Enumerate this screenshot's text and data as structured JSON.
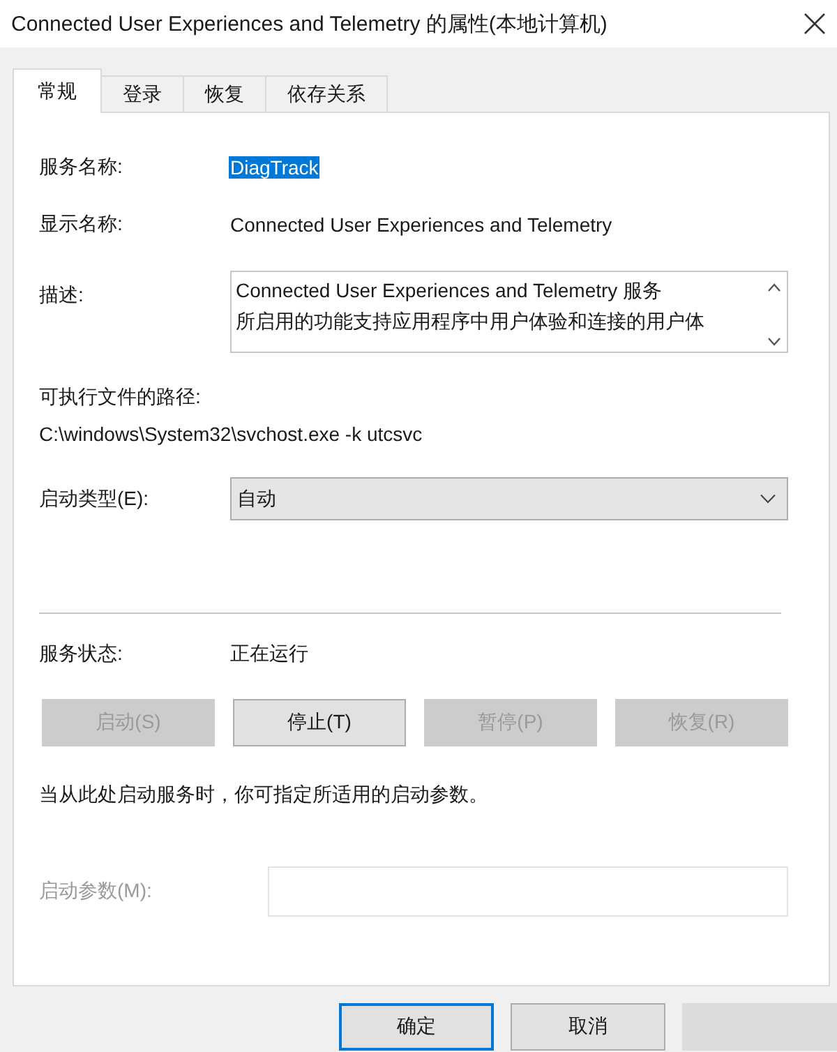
{
  "window": {
    "title": "Connected User Experiences and Telemetry 的属性(本地计算机)"
  },
  "tabs": [
    {
      "label": "常规",
      "selected": true
    },
    {
      "label": "登录",
      "selected": false
    },
    {
      "label": "恢复",
      "selected": false
    },
    {
      "label": "依存关系",
      "selected": false
    }
  ],
  "service_name": {
    "label": "服务名称:",
    "value": "DiagTrack",
    "highlighted": true
  },
  "display_name": {
    "label": "显示名称:",
    "value": "Connected User Experiences and Telemetry"
  },
  "description": {
    "label": "描述:",
    "lines": [
      "Connected User Experiences and Telemetry 服务",
      "所启用的功能支持应用程序中用户体验和连接的用户体"
    ]
  },
  "executable_path": {
    "label": "可执行文件的路径:",
    "value": "C:\\windows\\System32\\svchost.exe -k utcsvc"
  },
  "startup_type": {
    "label": "启动类型(E):",
    "value": "自动"
  },
  "service_status": {
    "label": "服务状态:",
    "value": "正在运行"
  },
  "service_buttons": [
    {
      "label": "启动(S)",
      "disabled": true
    },
    {
      "label": "停止(T)",
      "disabled": false
    },
    {
      "label": "暂停(P)",
      "disabled": true
    },
    {
      "label": "恢复(R)",
      "disabled": true
    }
  ],
  "hint": "当从此处启动服务时，你可指定所适用的启动参数。",
  "start_parameters": {
    "label": "启动参数(M):",
    "disabled": true
  },
  "dialog_buttons": [
    {
      "label": "确定",
      "focused": true,
      "disabled": false
    },
    {
      "label": "取消",
      "focused": false,
      "disabled": false
    },
    {
      "focused": false,
      "disabled": true
    }
  ]
}
